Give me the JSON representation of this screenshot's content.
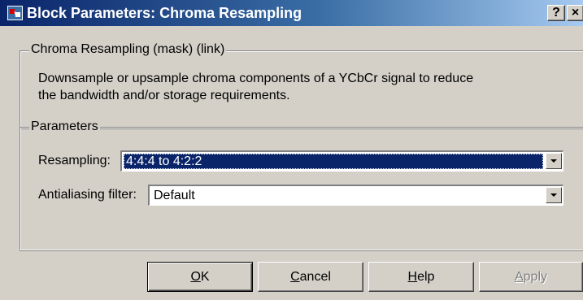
{
  "window": {
    "title": "Block Parameters: Chroma Resampling",
    "help_button": "?",
    "close_button": "×"
  },
  "description_group": {
    "legend": "Chroma Resampling (mask) (link)",
    "line1": "Downsample or upsample chroma components of a YCbCr signal to reduce",
    "line2": "the bandwidth and/or storage requirements."
  },
  "parameters_group": {
    "legend": "Parameters",
    "resampling": {
      "label": "Resampling:",
      "value": "4:4:4 to 4:2:2"
    },
    "antialiasing_filter": {
      "label": "Antialiasing filter:",
      "value": "Default"
    }
  },
  "buttons": {
    "ok": {
      "accel": "O",
      "rest": "K"
    },
    "cancel": {
      "accel": "C",
      "rest": "ancel"
    },
    "help": {
      "accel": "H",
      "rest": "elp"
    },
    "apply": {
      "accel": "A",
      "rest": "pply",
      "enabled": false
    }
  },
  "colors": {
    "title_bar": "#0a246a",
    "dialog_face": "#d4d0c8",
    "selection": "#0a246a"
  },
  "icons": {
    "title": "simulink-block-icon",
    "combo_arrow": "chevron-down-icon"
  }
}
